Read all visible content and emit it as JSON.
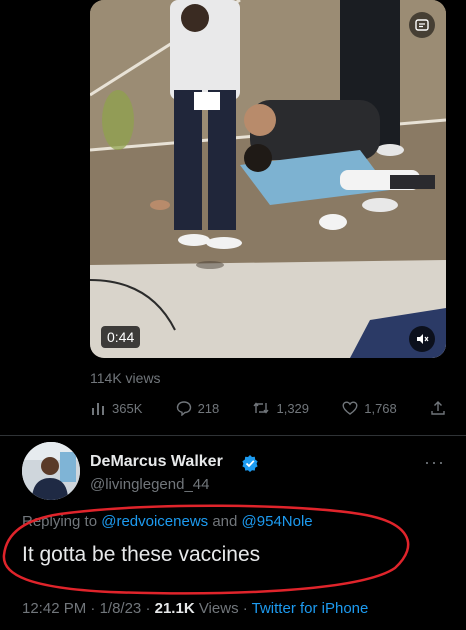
{
  "quoted_tweet": {
    "video": {
      "duration": "0:44",
      "mute_icon": "speaker-muted-icon",
      "corner_icon": "gif-icon"
    },
    "views_text": "114K views",
    "actions": {
      "views_count": "365K",
      "replies_count": "218",
      "retweets_count": "1,329",
      "likes_count": "1,768"
    }
  },
  "reply": {
    "author_name": "DeMarcus Walker",
    "author_handle": "@livinglegend_44",
    "replying_prefix": "Replying to ",
    "mention_1": "@redvoicenews",
    "replying_and": " and ",
    "mention_2": "@954Nole",
    "text": "It gotta be these vaccines",
    "time": "12:42 PM",
    "sep1": " · ",
    "date": "1/8/23",
    "sep2": " · ",
    "views_count": "21.1K",
    "views_label": " Views",
    "sep3": " · ",
    "source": "Twitter for iPhone"
  },
  "colors": {
    "background": "#000000",
    "text": "#e7e9ea",
    "muted": "#71767b",
    "link": "#1d9bf0",
    "annotation_circle": "#e0242b"
  }
}
